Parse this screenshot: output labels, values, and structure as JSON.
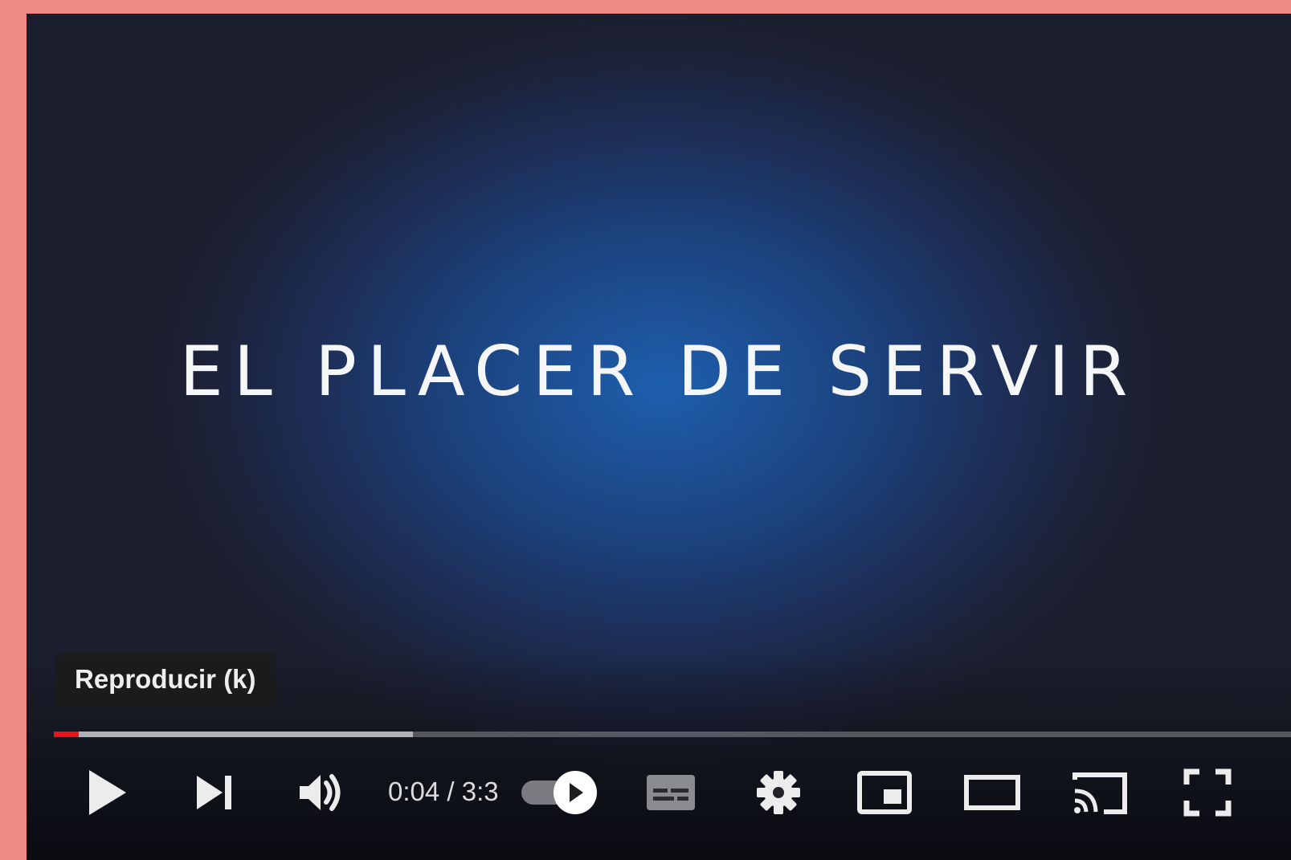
{
  "video": {
    "title_overlay": "EL PLACER DE SERVIR"
  },
  "tooltip": {
    "text": "Reproducir (k)"
  },
  "progress": {
    "played_fraction": 0.02,
    "buffered_fraction": 0.29
  },
  "controls": {
    "time_current": "0:04",
    "time_separator": "/",
    "time_total": "3:3",
    "autoplay_on": true,
    "icons": [
      "play-icon",
      "next-icon",
      "volume-icon",
      "autoplay-toggle-icon",
      "subtitles-icon",
      "settings-icon",
      "miniplayer-icon",
      "theater-mode-icon",
      "cast-icon",
      "fullscreen-icon"
    ]
  },
  "colors": {
    "background": "#f08a86",
    "progress_played": "#e8141c",
    "video_center": "#1d5fae",
    "video_edge": "#1b1e2c"
  }
}
